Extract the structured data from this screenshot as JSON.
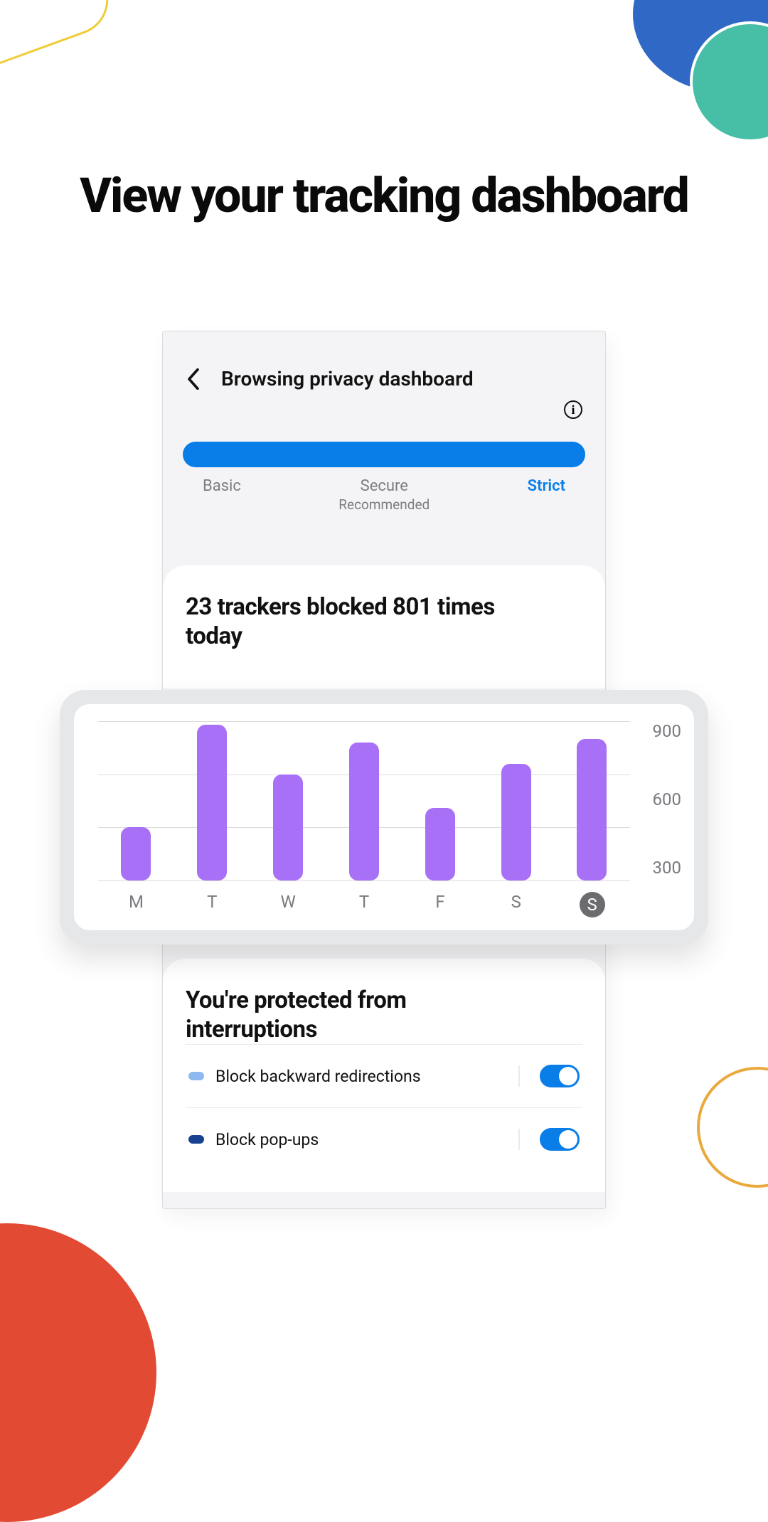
{
  "headline": "View your tracking dashboard",
  "appbar": {
    "title": "Browsing privacy dashboard"
  },
  "levels": {
    "basic": "Basic",
    "secure": "Secure",
    "secure_sub": "Recommended",
    "strict": "Strict"
  },
  "trackers_line1": "23 trackers blocked 801 times",
  "trackers_line2": "today",
  "protect_line1": "You're protected from",
  "protect_line2": "interruptions",
  "settings": {
    "backward": {
      "label": "Block backward redirections",
      "on": true,
      "icon_color": "#8db8ef"
    },
    "popups": {
      "label": "Block pop-ups",
      "on": true,
      "icon_color": "#18428f"
    }
  },
  "chart_data": {
    "type": "bar",
    "categories": [
      "M",
      "T",
      "W",
      "T",
      "F",
      "S",
      "S"
    ],
    "values": [
      300,
      880,
      600,
      780,
      410,
      660,
      800
    ],
    "today_index": 6,
    "ylim": [
      0,
      900
    ],
    "yticks": [
      900,
      600,
      300
    ],
    "title": "",
    "xlabel": "",
    "ylabel": "",
    "bar_color": "#a770f6"
  }
}
